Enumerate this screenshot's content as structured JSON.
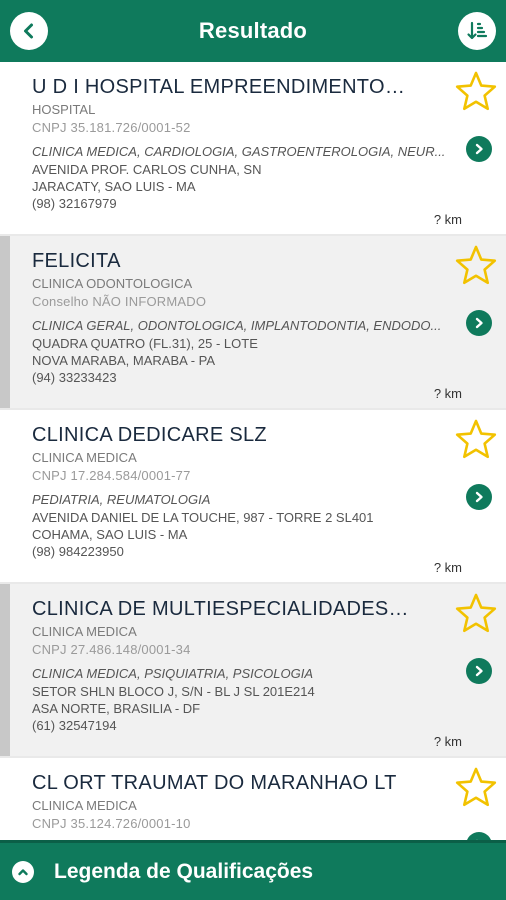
{
  "header": {
    "title": "Resultado"
  },
  "results": [
    {
      "name": "U D I HOSPITAL EMPREENDIMENTOS M...",
      "type": "HOSPITAL",
      "registration": "CNPJ 35.181.726/0001-52",
      "specialties": "CLINICA MEDICA, CARDIOLOGIA, GASTROENTEROLOGIA, NEUR...",
      "address_line1": "AVENIDA PROF. CARLOS CUNHA, SN",
      "address_line2": "JARACATY, SAO LUIS - MA",
      "phone": "(98) 32167979",
      "distance": "? km"
    },
    {
      "name": "FELICITA",
      "type": "CLINICA ODONTOLOGICA",
      "registration": "Conselho NÃO INFORMADO",
      "specialties": "CLINICA GERAL, ODONTOLOGICA, IMPLANTODONTIA, ENDODO...",
      "address_line1": "QUADRA QUATRO (FL.31), 25 - LOTE",
      "address_line2": "NOVA MARABA, MARABA - PA",
      "phone": "(94) 33233423",
      "distance": "? km"
    },
    {
      "name": "CLINICA DEDICARE SLZ",
      "type": "CLINICA MEDICA",
      "registration": "CNPJ 17.284.584/0001-77",
      "specialties": "PEDIATRIA, REUMATOLOGIA",
      "address_line1": "AVENIDA DANIEL DE LA TOUCHE, 987 - TORRE 2 SL401",
      "address_line2": "COHAMA, SAO LUIS - MA",
      "phone": "(98) 984223950",
      "distance": "? km"
    },
    {
      "name": "CLINICA DE MULTIESPECIALIDADES ARR...",
      "type": "CLINICA MEDICA",
      "registration": "CNPJ 27.486.148/0001-34",
      "specialties": "CLINICA MEDICA, PSIQUIATRIA, PSICOLOGIA",
      "address_line1": "SETOR SHLN BLOCO J, S/N - BL J SL 201E214",
      "address_line2": "ASA NORTE, BRASILIA - DF",
      "phone": "(61) 32547194",
      "distance": "? km"
    },
    {
      "name": "CL ORT TRAUMAT DO MARANHAO LT",
      "type": "CLINICA MEDICA",
      "registration": "CNPJ 35.124.726/0001-10",
      "specialties": "",
      "address_line1": "",
      "address_line2": "",
      "phone": "",
      "distance": ""
    }
  ],
  "footer": {
    "label": "Legenda de Qualificações"
  },
  "icons": {
    "back": "chevron-left-icon",
    "sort": "sort-icon",
    "favorite": "star-outline-icon",
    "open": "chevron-right-circle-icon",
    "expand": "chevron-up-icon"
  },
  "colors": {
    "brand": "#0f7a5c",
    "star": "#f2c200"
  }
}
